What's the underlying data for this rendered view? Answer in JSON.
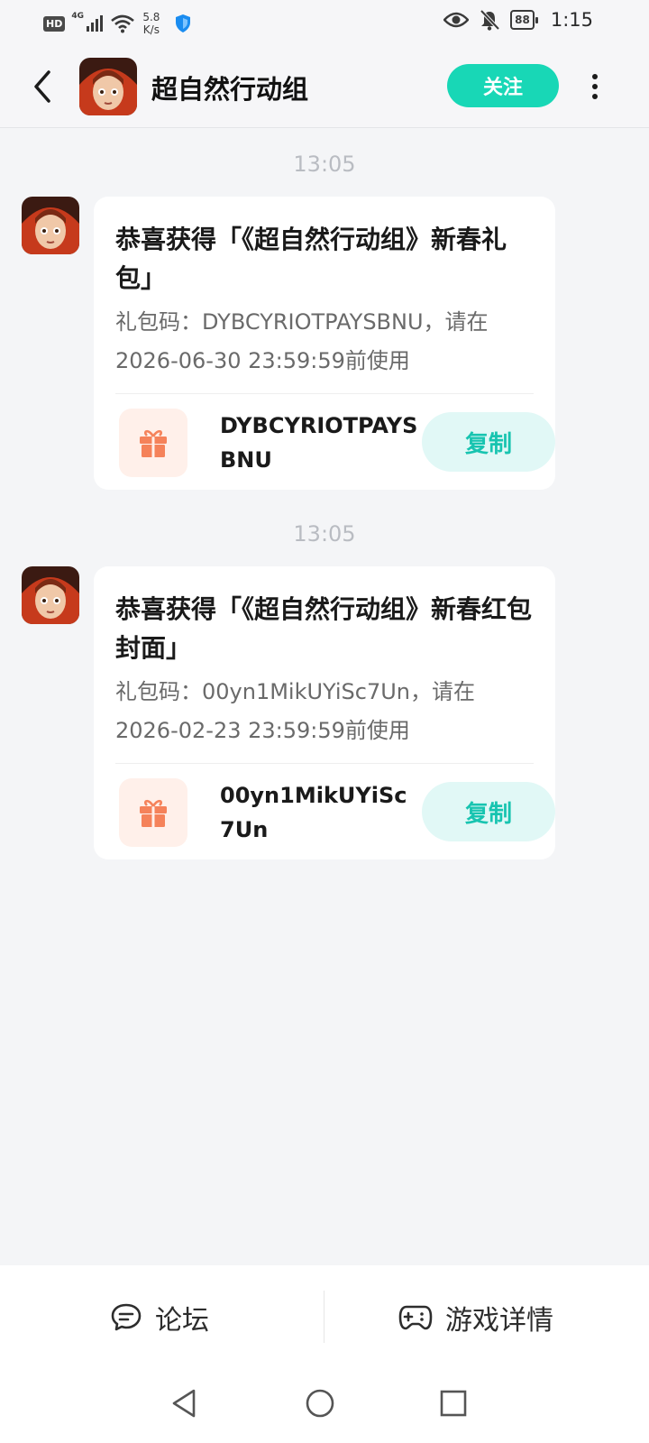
{
  "status_bar": {
    "hd": "HD",
    "network": "4G",
    "speed_value": "5.8",
    "speed_unit": "K/s",
    "battery": "88",
    "time": "1:15"
  },
  "header": {
    "title": "超自然行动组",
    "follow_label": "关注",
    "back_icon": "back-arrow-icon",
    "more_icon": "more-vertical-icon"
  },
  "messages": [
    {
      "timestamp": "13:05",
      "title": "恭喜获得「《超自然行动组》新春礼包」",
      "description": "礼包码：DYBCYRIOTPAYSBNU，请在2026-06-30 23:59:59前使用",
      "code": "DYBCYRIOTPAYSBNU",
      "copy_label": "复制"
    },
    {
      "timestamp": "13:05",
      "title": "恭喜获得「《超自然行动组》新春红包封面」",
      "description": "礼包码：00yn1MikUYiSc7Un，请在2026-02-23 23:59:59前使用",
      "code": "00yn1MikUYiSc7Un",
      "copy_label": "复制"
    }
  ],
  "bottom_tabs": {
    "forum": "论坛",
    "game_detail": "游戏详情"
  },
  "colors": {
    "accent": "#18d7b6",
    "copy_text": "#18c4b0",
    "gift_orange": "#f5825a",
    "background": "#f4f5f7"
  }
}
